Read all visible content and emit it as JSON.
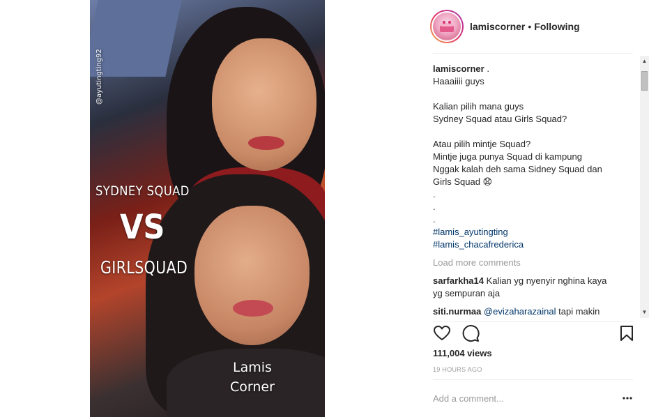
{
  "media": {
    "overlay_handle": "@ayutingting92",
    "overlay_line1": "SYDNEY SQUAD",
    "overlay_vs": "VS",
    "overlay_line2": "GIRLSQUAD",
    "watermark_line1": "Lamis",
    "watermark_line2": "Corner"
  },
  "header": {
    "username": "lamiscorner",
    "separator": "•",
    "follow_status": "Following",
    "avatar_icon": "lamis-corner-logo"
  },
  "caption": {
    "username": "lamiscorner",
    "username_suffix": " .",
    "lines": [
      "Haaaiiii guys",
      "",
      "Kalian pilih mana guys",
      "Sydney Squad atau Girls Squad?",
      "",
      "Atau pilih mintje Squad?",
      "Mintje juga punya Squad di kampung",
      "Nggak kalah deh sama Sidney Squad dan",
      "Girls Squad 😧",
      ".",
      ".",
      "."
    ],
    "hashtags": [
      "#lamis_ayutingting",
      "#lamis_chacafrederica"
    ]
  },
  "load_more": "Load more comments",
  "comments": [
    {
      "user": "sarfarkha14",
      "text": " Kalian yg nyenyir nghina kaya",
      "text2": "yg sempuran aja"
    },
    {
      "user": "siti.nurmaa",
      "mention": "@evizaharazainal",
      "text": " tapi makin"
    }
  ],
  "actions": {
    "like_icon": "heart-icon",
    "comment_icon": "comment-icon",
    "save_icon": "bookmark-icon"
  },
  "stats": {
    "views": "111,004 views",
    "time_ago": "19 HOURS AGO"
  },
  "add_comment": {
    "placeholder": "Add a comment...",
    "more_icon": "more-options-icon"
  },
  "scrollbar": {
    "up_arrow": "▲",
    "down_arrow": "▼"
  }
}
